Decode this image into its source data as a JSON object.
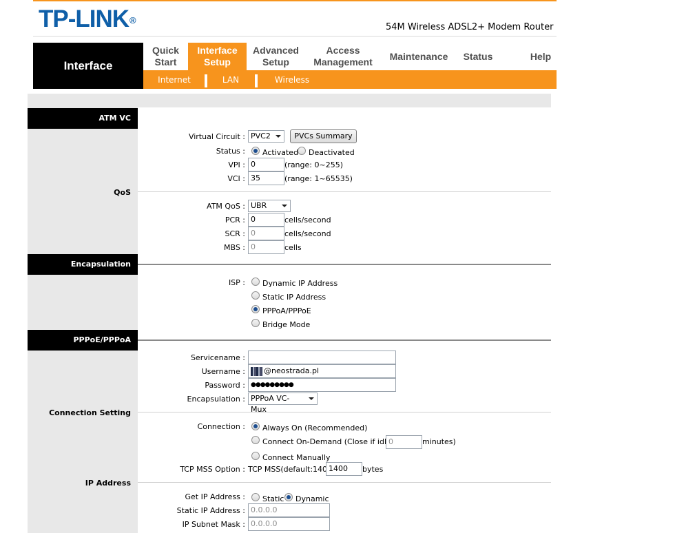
{
  "header": {
    "logo": "TP-LINK",
    "logo_mark": "®",
    "model": "54M Wireless ADSL2+ Modem Router"
  },
  "nav": {
    "section_title": "Interface",
    "tabs": [
      {
        "label": "Quick\nStart"
      },
      {
        "label": "Interface\nSetup",
        "active": true
      },
      {
        "label": "Advanced\nSetup"
      },
      {
        "label": "Access\nManagement"
      },
      {
        "label": "Maintenance"
      },
      {
        "label": "Status"
      },
      {
        "label": "Help"
      }
    ],
    "subtabs": [
      {
        "label": "Internet",
        "active": true
      },
      {
        "label": "LAN"
      },
      {
        "label": "Wireless"
      }
    ],
    "accent": "#f7941d"
  },
  "atm": {
    "section": "ATM VC",
    "virtual_circuit_label": "Virtual Circuit :",
    "virtual_circuit_value": "PVC2",
    "pvcs_summary_label": "PVCs Summary",
    "status_label": "Status :",
    "status_activated": "Activated",
    "status_deactivated": "Deactivated",
    "vpi_label": "VPI :",
    "vpi_value": "0",
    "vpi_range": "(range: 0~255)",
    "vci_label": "VCI :",
    "vci_value": "35",
    "vci_range": "(range: 1~65535)"
  },
  "qos": {
    "section": "QoS",
    "atm_qos_label": "ATM QoS :",
    "atm_qos_value": "UBR",
    "pcr_label": "PCR :",
    "pcr_value": "0",
    "pcr_unit": "cells/second",
    "scr_label": "SCR :",
    "scr_value": "0",
    "scr_unit": "cells/second",
    "mbs_label": "MBS :",
    "mbs_value": "0",
    "mbs_unit": "cells"
  },
  "encapsulation": {
    "section": "Encapsulation",
    "isp_label": "ISP :",
    "options": [
      "Dynamic IP Address",
      "Static IP Address",
      "PPPoA/PPPoE",
      "Bridge Mode"
    ],
    "selected": "PPPoA/PPPoE"
  },
  "pppoe": {
    "section": "PPPoE/PPPoA",
    "servicename_label": "Servicename :",
    "servicename_value": "",
    "username_label": "Username :",
    "username_value": "@neostrada.pl",
    "password_label": "Password :",
    "password_value": "●●●●●●●●●",
    "encap_label": "Encapsulation :",
    "encap_value": "PPPoA VC-Mux"
  },
  "connection": {
    "section": "Connection Setting",
    "connection_label": "Connection :",
    "always_on": "Always On (Recommended)",
    "on_demand": "Connect On-Demand (Close if idle for",
    "on_demand_value": "0",
    "on_demand_unit": "minutes)",
    "manual": "Connect Manually",
    "mss_label": "TCP MSS Option :",
    "mss_text": "TCP MSS(default:1400)",
    "mss_value": "1400",
    "mss_unit": "bytes"
  },
  "ip": {
    "section": "IP Address",
    "get_ip_label": "Get IP Address :",
    "static": "Static",
    "dynamic": "Dynamic",
    "static_ip_label": "Static IP Address :",
    "static_ip_value": "0.0.0.0",
    "subnet_label": "IP Subnet Mask :",
    "subnet_value": "0.0.0.0"
  }
}
